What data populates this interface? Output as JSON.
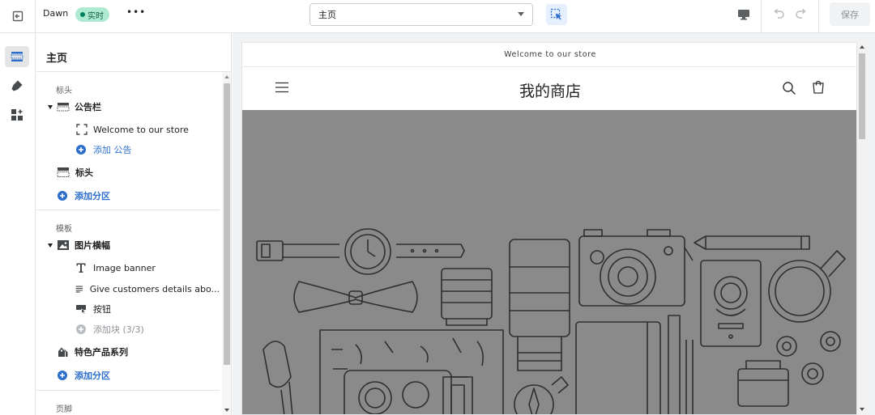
{
  "topbar": {
    "theme_name": "Dawn",
    "live_badge": "实时",
    "more": "•••",
    "page_select_value": "主页",
    "save_label": "保存"
  },
  "sidebar": {
    "title": "主页",
    "header_group": {
      "label": "标头",
      "announcement_bar": "公告栏",
      "announcement_item": "Welcome to our store",
      "add_announcement": "添加 公告",
      "header": "标头",
      "add_section": "添加分区"
    },
    "template_group": {
      "label": "模板",
      "image_banner": "图片横幅",
      "block_heading": "Image banner",
      "block_text": "Give customers details abo...",
      "block_button": "按钮",
      "add_block": "添加块 (3/3)",
      "featured_collection": "特色产品系列",
      "add_section": "添加分区"
    },
    "footer_group": {
      "label": "页脚"
    }
  },
  "preview": {
    "announcement_text": "Welcome to our store",
    "store_name": "我的商店"
  },
  "colors": {
    "accent": "#2c6ecb",
    "live_badge_bg": "#aee9d1",
    "banner_bg": "#8a8a8a"
  }
}
